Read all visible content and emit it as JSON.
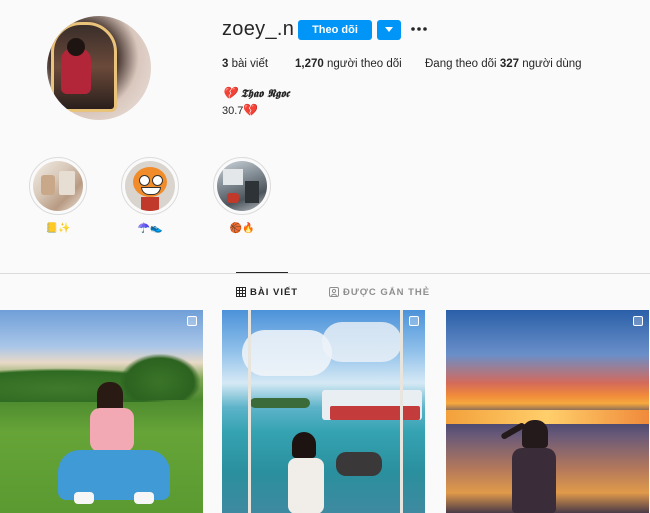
{
  "profile": {
    "username": "zoey_.n",
    "follow_label": "Theo dõi",
    "stats": {
      "posts_count": "3",
      "posts_label": "bài viết",
      "followers_count": "1,270",
      "followers_label": "người theo dõi",
      "following_prefix": "Đang theo dõi",
      "following_count": "327",
      "following_suffix": "người dùng"
    },
    "bio": {
      "name": "𝕿𝖍𝖆𝖔 𝕹𝖌𝖔𝖈",
      "name_emoji": "💔",
      "line": "30.7",
      "line_emoji": "💔"
    }
  },
  "highlights": [
    {
      "label": "📒✨"
    },
    {
      "label": "☂️👟"
    },
    {
      "label": "🏀🔥"
    }
  ],
  "tabs": {
    "posts": "BÀI VIẾT",
    "tagged": "ĐƯỢC GẮN THẺ"
  },
  "colors": {
    "accent": "#0095f6",
    "text": "#262626",
    "muted": "#8e8e8e",
    "border": "#dbdbdb",
    "background": "#fafafa"
  },
  "icons": {
    "dropdown": "chevron-down-icon",
    "more": "more-horizontal-icon",
    "grid": "grid-icon",
    "tagged": "tagged-person-icon",
    "multi_post": "carousel-icon"
  }
}
